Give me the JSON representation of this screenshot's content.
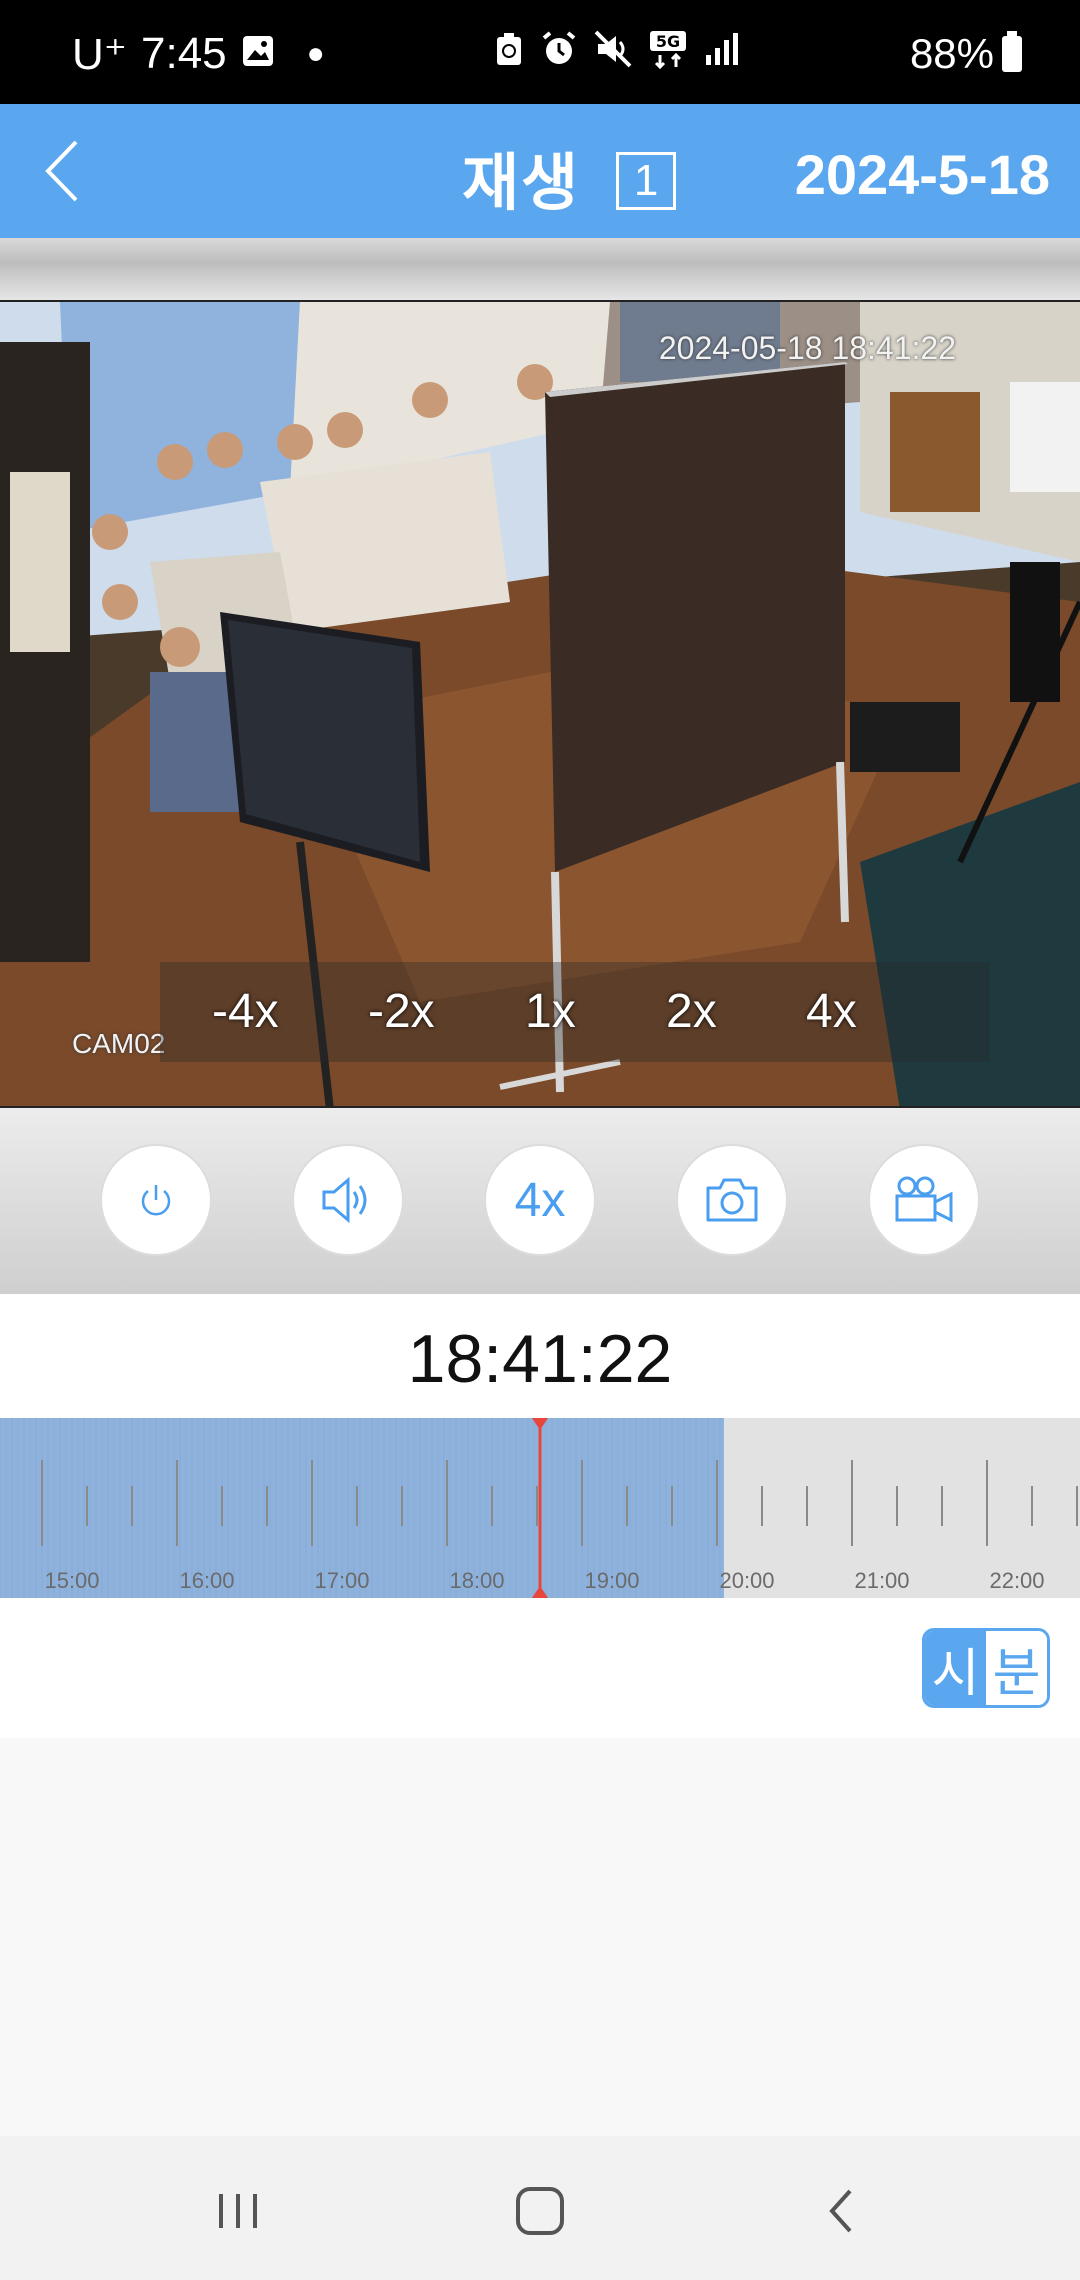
{
  "status_bar": {
    "carrier": "U⁺",
    "time": "7:45",
    "battery": "88%",
    "icons": [
      "image-icon",
      "dot-icon",
      "recycle-icon",
      "alarm-icon",
      "mute-icon",
      "5g-icon",
      "signal-icon",
      "battery-icon"
    ]
  },
  "header": {
    "title": "재생",
    "channel": "1",
    "date": "2024-5-18",
    "accent_color": "#5aa7f0"
  },
  "video": {
    "osd_timestamp": "2024-05-18 18:41:22",
    "camera_label": "CAM02",
    "speed_options": [
      "-4x",
      "-2x",
      "1x",
      "2x",
      "4x"
    ]
  },
  "controls": {
    "power_icon": "power-icon",
    "audio_icon": "speaker-icon",
    "speed_label": "4x",
    "snapshot_icon": "camera-icon",
    "record_icon": "video-camera-icon"
  },
  "playback": {
    "current_time": "18:41:22"
  },
  "timeline": {
    "hour_labels": [
      "15:00",
      "16:00",
      "17:00",
      "18:00",
      "19:00",
      "20:00",
      "21:00",
      "22:00"
    ],
    "recorded_color": "#8fb2dd",
    "cursor_color": "#e8453c"
  },
  "zoom_toggle": {
    "hour_label": "시",
    "minute_label": "분"
  }
}
